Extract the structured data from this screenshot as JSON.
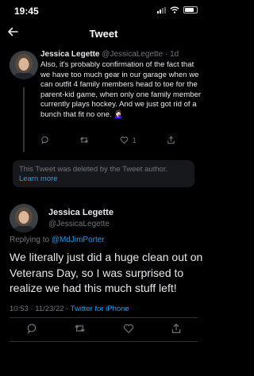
{
  "status_bar": {
    "time": "19:45"
  },
  "header": {
    "title": "Tweet",
    "back_icon": "arrow-left-icon"
  },
  "parent_tweet": {
    "name": "Jessica Legette",
    "handle": "@JessicaLegette",
    "separator": "·",
    "time": "1d",
    "text": "Also, it's probably confirmation of the fact that we have too much gear in our garage when we can outfit 4 family members head to toe for the parent-kid game, when only one family member currently plays hockey. And we just got rid of a bunch that fit no one. 🤦🏻‍♀️",
    "likes": "1"
  },
  "deleted_notice": {
    "text": "This Tweet was deleted by the Tweet author.",
    "link": "Learn more"
  },
  "main_tweet": {
    "name": "Jessica Legette",
    "handle": "@JessicaLegette",
    "replying_label": "Replying to",
    "replying_to": "@MdJimPorter",
    "text": "We literally just did a huge clean out on Veterans Day, so I was surprised to realize we had this much stuff left!",
    "time": "10:53",
    "separator": "·",
    "date": "11/23/22",
    "separator2": "·",
    "source": "Twitter for iPhone"
  },
  "colors": {
    "background": "#000000",
    "accent": "#1d9bf0",
    "muted": "#71767b",
    "text": "#e7e9ea"
  }
}
